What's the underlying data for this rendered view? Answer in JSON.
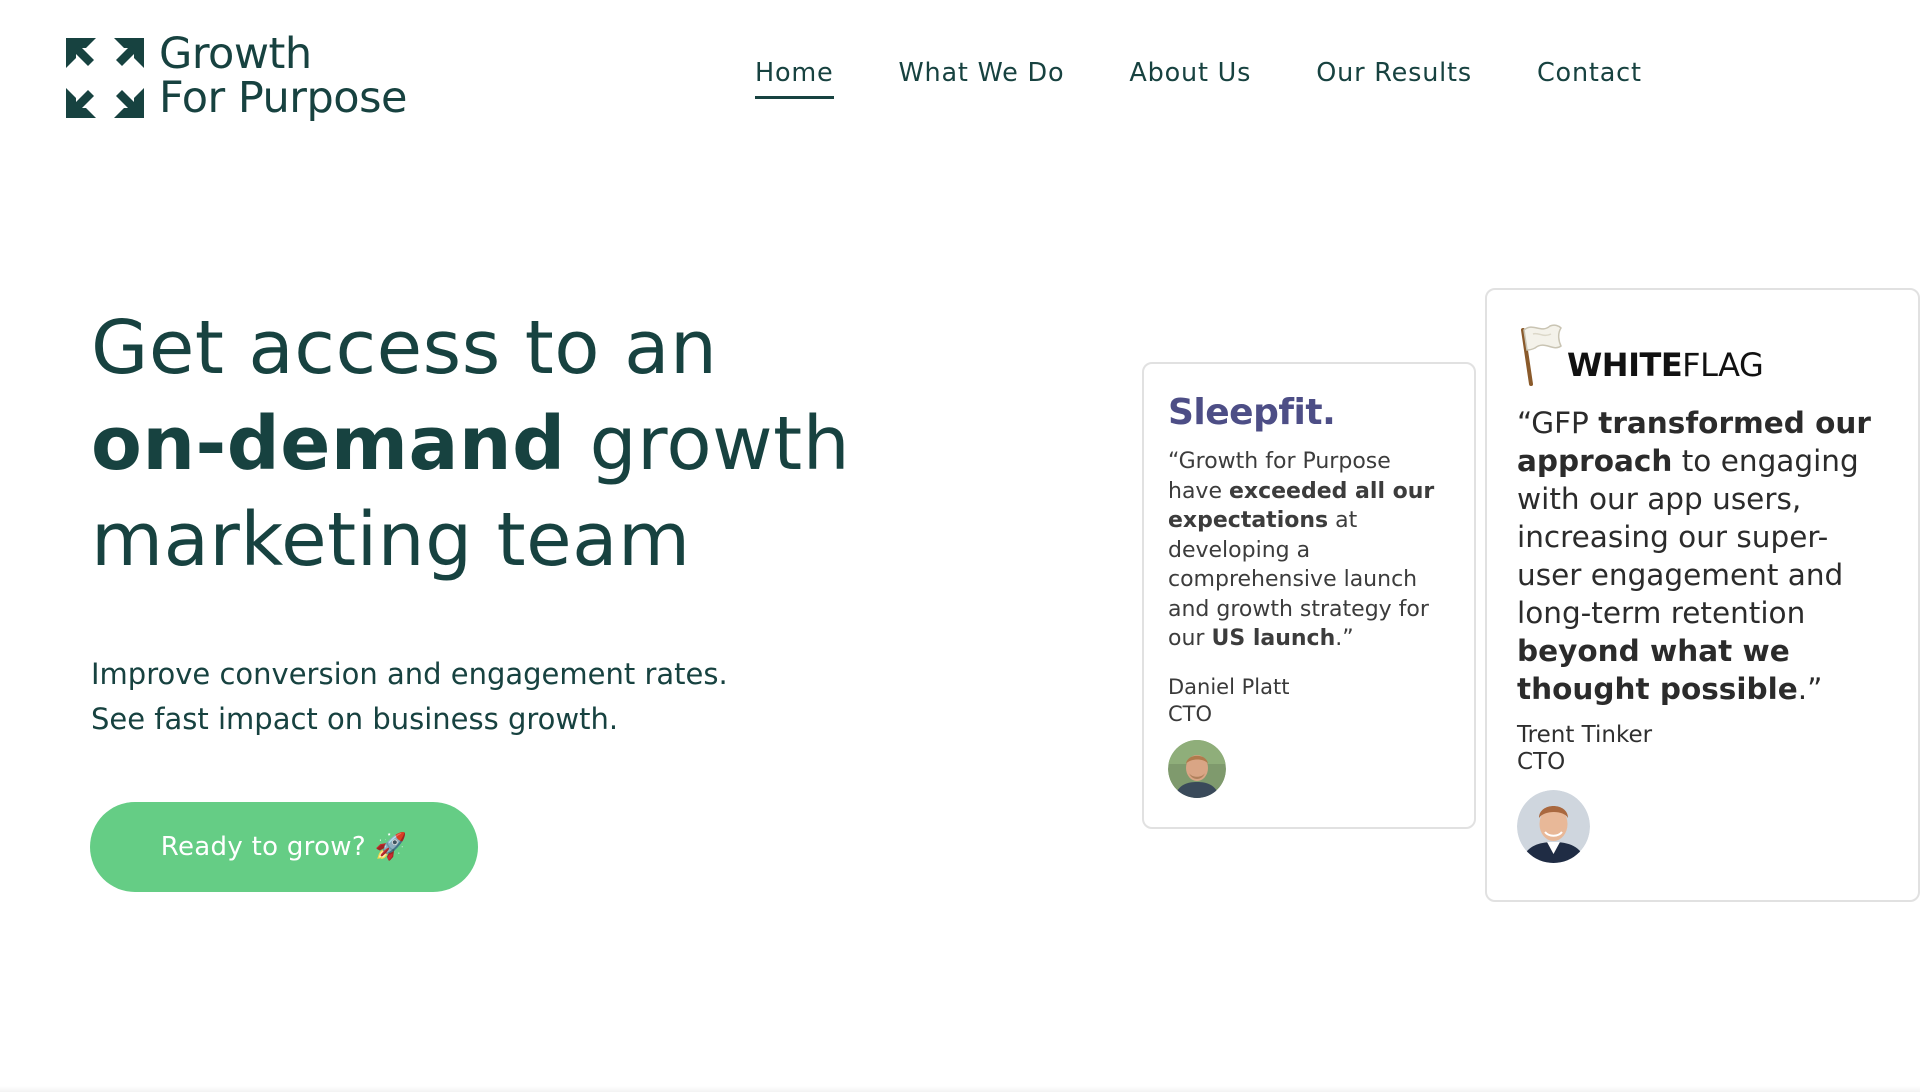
{
  "header": {
    "logo_line1": "Growth",
    "logo_line2": "For Purpose",
    "nav": [
      {
        "label": "Home",
        "active": true
      },
      {
        "label": "What We Do"
      },
      {
        "label": "About Us"
      },
      {
        "label": "Our Results"
      },
      {
        "label": "Contact"
      }
    ]
  },
  "hero": {
    "title_line1": "Get access to an",
    "title_line2_bold": "on-demand",
    "title_line2_rest": " growth",
    "title_line3": "marketing team",
    "sub_line1": "Improve conversion and engagement rates.",
    "sub_line2": "See fast impact on business growth.",
    "cta_label": "Ready to grow? 🚀"
  },
  "testimonials": [
    {
      "company": "Sleepfit.",
      "quote_parts": [
        "“Growth for Purpose have ",
        "exceeded all our expectations",
        " at developing a comprehensive launch and growth strategy for our ",
        "US launch",
        ".”"
      ],
      "name": "Daniel Platt",
      "role": "CTO"
    },
    {
      "company_bold": "WHITE",
      "company_rest": "FLAG",
      "quote_parts": [
        "“GFP ",
        "transformed our approach",
        " to engaging with our app users, increasing our super-user engagement and long-term retention ",
        "beyond what we thought possible",
        ".”"
      ],
      "name": "Trent Tinker",
      "role": "CTO"
    }
  ],
  "colors": {
    "brand_dark": "#174240",
    "cta_green": "#65cd85",
    "sleepfit_purple": "#4d4e86"
  }
}
